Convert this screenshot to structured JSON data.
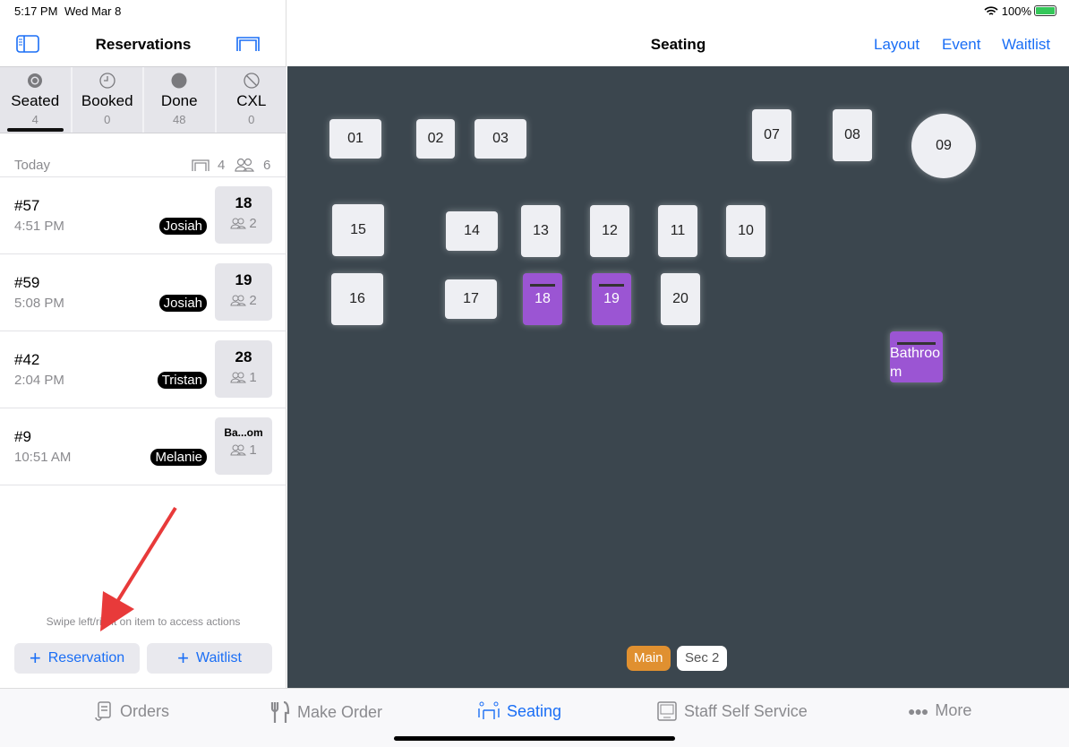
{
  "status": {
    "time": "5:17 PM",
    "date": "Wed Mar 8",
    "battery": "100%"
  },
  "left": {
    "title": "Reservations",
    "segments": [
      {
        "label": "Seated",
        "count": "4",
        "icon": "target-circle-icon",
        "active": true
      },
      {
        "label": "Booked",
        "count": "0",
        "icon": "clock-icon"
      },
      {
        "label": "Done",
        "count": "48",
        "icon": "filled-circle-icon"
      },
      {
        "label": "CXL",
        "count": "0",
        "icon": "slashed-circle-icon"
      }
    ],
    "section": {
      "label": "Today",
      "tables": "4",
      "guests": "6"
    },
    "rows": [
      {
        "number": "#57",
        "time": "4:51 PM",
        "server": "Josiah",
        "table": "18",
        "guests": "2"
      },
      {
        "number": "#59",
        "time": "5:08 PM",
        "server": "Josiah",
        "table": "19",
        "guests": "2"
      },
      {
        "number": "#42",
        "time": "2:04 PM",
        "server": "Tristan",
        "table": "28",
        "guests": "1"
      },
      {
        "number": "#9",
        "time": "10:51 AM",
        "server": "Melanie",
        "table": "Ba...om",
        "guests": "1"
      }
    ],
    "hint": "Swipe left/right on item to access actions",
    "add_reservation": "Reservation",
    "add_waitlist": "Waitlist"
  },
  "main": {
    "title": "Seating",
    "links": [
      "Layout",
      "Event",
      "Waitlist"
    ],
    "tables": [
      "01",
      "02",
      "03",
      "07",
      "08",
      "09",
      "15",
      "14",
      "13",
      "12",
      "11",
      "10",
      "16",
      "17",
      "18",
      "19",
      "20",
      "Bathroom"
    ],
    "occupied": [
      "18",
      "19",
      "Bathroom"
    ],
    "sections": [
      "Main",
      "Sec 2"
    ],
    "active_section": "Main"
  },
  "colors": {
    "accent": "#1a6ef5",
    "occupied": "#9b55d3",
    "section_active": "#e09030",
    "floor": "#3b464e"
  },
  "tabbar": [
    {
      "label": "Orders",
      "icon": "receipt-icon"
    },
    {
      "label": "Make Order",
      "icon": "fork-knife-icon"
    },
    {
      "label": "Seating",
      "icon": "seating-icon",
      "active": true
    },
    {
      "label": "Staff Self Service",
      "icon": "kiosk-icon"
    },
    {
      "label": "More",
      "icon": "more-dots-icon"
    }
  ]
}
